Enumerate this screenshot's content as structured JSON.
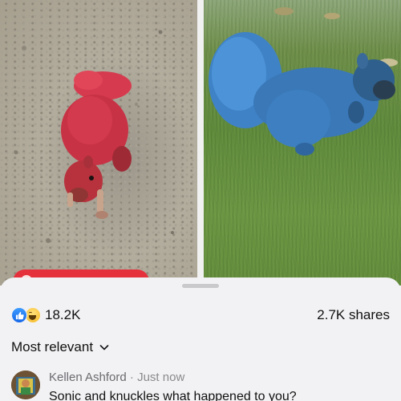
{
  "post": {
    "photos": [
      {
        "name": "red-squirrel-photo"
      },
      {
        "name": "blue-squirrel-photo"
      }
    ]
  },
  "sheet": {
    "reactions": {
      "icons": [
        "like-icon",
        "haha-icon"
      ],
      "count": "18.2K"
    },
    "shares": "2.7K shares",
    "sort_label": "Most relevant",
    "comments": [
      {
        "author": "Kellen Ashford",
        "separator": "·",
        "time": "Just now",
        "text": "Sonic and knuckles what happened to you?"
      }
    ]
  },
  "colors": {
    "like_blue": "#1877f2",
    "tag_red": "#e5313c",
    "sheet_bg": "#f2f2f4"
  }
}
